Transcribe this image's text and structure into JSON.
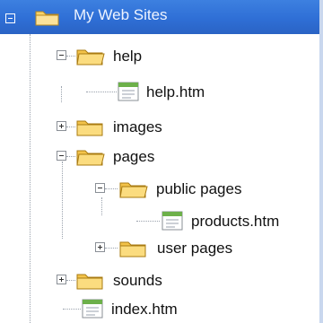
{
  "window": {
    "title": "My Web Sites"
  },
  "tree": {
    "help": "help",
    "help_htm": "help.htm",
    "images": "images",
    "pages": "pages",
    "public_pages": "public pages",
    "products_htm": "products.htm",
    "user_pages": "user pages",
    "sounds": "sounds",
    "index_htm": "index.htm"
  },
  "icons": {
    "folder": "folder-icon",
    "html_file": "html-file-icon",
    "expand": "plus-box-icon",
    "collapse": "minus-box-icon"
  },
  "colors": {
    "header": "#2f6fd6",
    "folder": "#f3c34a",
    "side_strip": "#c9d7ee"
  }
}
